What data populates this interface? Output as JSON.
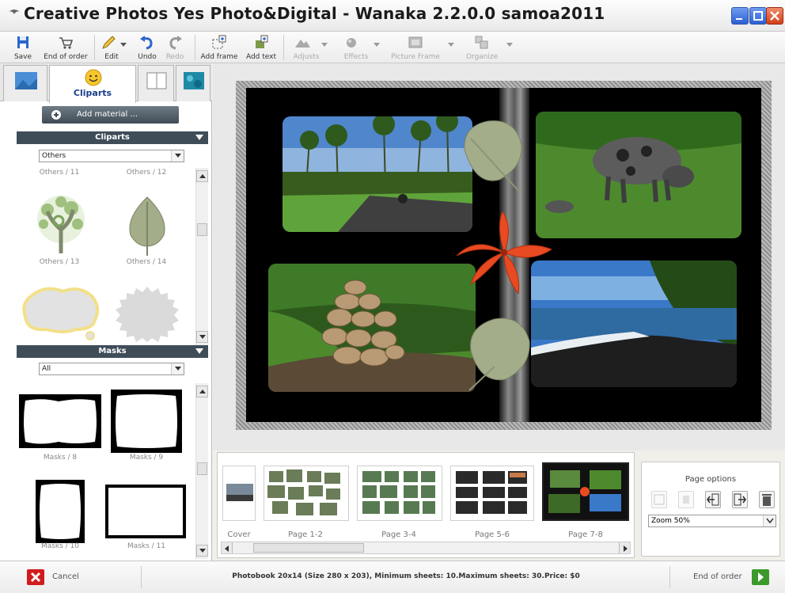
{
  "window": {
    "title": "Creative Photos Yes Photo&Digital - Wanaka 2.2.0.0 samoa2011"
  },
  "toolbar": {
    "save": "Save",
    "end_of_order": "End of order",
    "edit": "Edit",
    "undo": "Undo",
    "redo": "Redo",
    "add_frame": "Add frame",
    "add_text": "Add text",
    "adjusts": "Adjusts",
    "effects": "Effects",
    "picture_frame": "Picture Frame",
    "organize": "Organize"
  },
  "left_panel": {
    "active_tab": "Cliparts",
    "add_material": "Add material ...",
    "cliparts": {
      "header": "Cliparts",
      "category": "Others",
      "items": [
        "Others / 11",
        "Others / 12",
        "Others / 13",
        "Others / 14"
      ]
    },
    "masks": {
      "header": "Masks",
      "category": "All",
      "items": [
        "Masks / 8",
        "Masks / 9",
        "Masks / 10",
        "Masks / 11"
      ]
    }
  },
  "pages": {
    "labels": [
      "Cover",
      "Page 1-2",
      "Page 3-4",
      "Page 5-6",
      "Page 7-8"
    ],
    "selected": "Page 7-8"
  },
  "page_options": {
    "title": "Page options",
    "zoom": "Zoom 50%"
  },
  "footer": {
    "cancel": "Cancel",
    "info": "Photobook 20x14 (Size 280 x 203), Minimum sheets: 10.Maximum sheets: 30.Price: $0",
    "end_of_order": "End of order"
  },
  "colors": {
    "accent": "#1a3e8a",
    "section_header": "#3f4d59",
    "cancel_red": "#d21c1c",
    "go_green": "#3c9a2a",
    "flower": "#e84a22",
    "leaf": "#a3ad8a"
  }
}
